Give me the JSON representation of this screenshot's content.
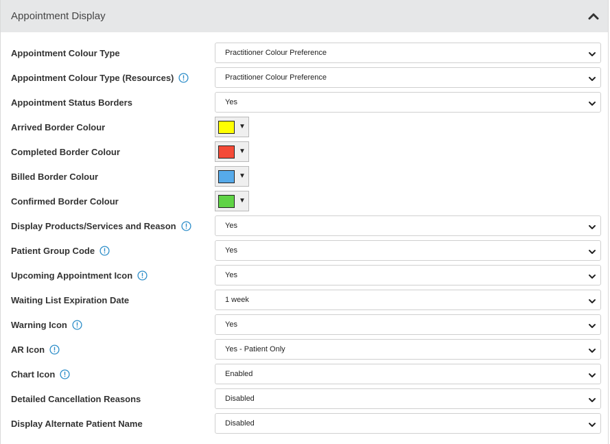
{
  "panel": {
    "title": "Appointment Display"
  },
  "rows": [
    {
      "label": "Appointment Colour Type",
      "info": false,
      "kind": "select",
      "value": "Practitioner Colour Preference"
    },
    {
      "label": "Appointment Colour Type (Resources)",
      "info": true,
      "kind": "select",
      "value": "Practitioner Colour Preference"
    },
    {
      "label": "Appointment Status Borders",
      "info": false,
      "kind": "select",
      "value": "Yes"
    },
    {
      "label": "Arrived Border Colour",
      "info": false,
      "kind": "color",
      "color": "#ffff00"
    },
    {
      "label": "Completed Border Colour",
      "info": false,
      "kind": "color",
      "color": "#f44a37"
    },
    {
      "label": "Billed Border Colour",
      "info": false,
      "kind": "color",
      "color": "#56aaea"
    },
    {
      "label": "Confirmed Border Colour",
      "info": false,
      "kind": "color",
      "color": "#5fd345"
    },
    {
      "label": "Display Products/Services and Reason",
      "info": true,
      "kind": "select",
      "value": "Yes"
    },
    {
      "label": "Patient Group Code",
      "info": true,
      "kind": "select",
      "value": "Yes"
    },
    {
      "label": "Upcoming Appointment Icon",
      "info": true,
      "kind": "select",
      "value": "Yes"
    },
    {
      "label": "Waiting List Expiration Date",
      "info": false,
      "kind": "select",
      "value": "1 week"
    },
    {
      "label": "Warning Icon",
      "info": true,
      "kind": "select",
      "value": "Yes"
    },
    {
      "label": "AR Icon",
      "info": true,
      "kind": "select",
      "value": "Yes - Patient Only"
    },
    {
      "label": "Chart Icon",
      "info": true,
      "kind": "select",
      "value": "Enabled"
    },
    {
      "label": "Detailed Cancellation Reasons",
      "info": false,
      "kind": "select",
      "value": "Disabled"
    },
    {
      "label": "Display Alternate Patient Name",
      "info": false,
      "kind": "select",
      "value": "Disabled"
    }
  ],
  "theme": {
    "info_color": "#2a8cc8",
    "header_bg": "#e6e7e8"
  }
}
